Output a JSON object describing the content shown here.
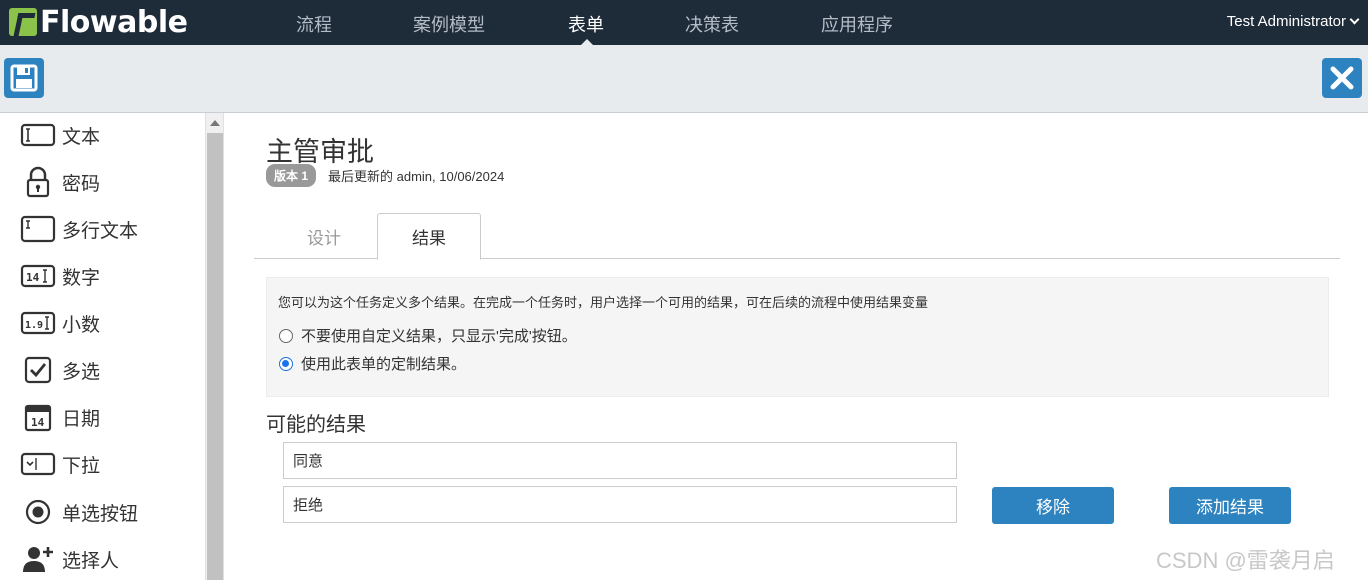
{
  "app": {
    "logo_text": "Flowable",
    "nav": [
      {
        "label": "流程",
        "active": false
      },
      {
        "label": "案例模型",
        "active": false
      },
      {
        "label": "表单",
        "active": true
      },
      {
        "label": "决策表",
        "active": false
      },
      {
        "label": "应用程序",
        "active": false
      }
    ],
    "user": "Test Administrator"
  },
  "toolbar": {
    "save_icon": "floppy-disk-icon",
    "close_icon": "close-x-icon"
  },
  "palette": {
    "items": [
      {
        "label": "文本",
        "icon": "text-field-icon"
      },
      {
        "label": "密码",
        "icon": "lock-icon"
      },
      {
        "label": "多行文本",
        "icon": "multiline-text-icon"
      },
      {
        "label": "数字",
        "icon": "number-icon"
      },
      {
        "label": "小数",
        "icon": "decimal-icon"
      },
      {
        "label": "多选",
        "icon": "checkbox-icon"
      },
      {
        "label": "日期",
        "icon": "calendar-icon"
      },
      {
        "label": "下拉",
        "icon": "dropdown-icon"
      },
      {
        "label": "单选按钮",
        "icon": "radio-button-icon"
      },
      {
        "label": "选择人",
        "icon": "add-person-icon"
      }
    ]
  },
  "form": {
    "title": "主管审批",
    "version_badge": "版本 1",
    "last_updated": "最后更新的 admin, 10/06/2024",
    "tabs": [
      {
        "label": "设计",
        "active": false
      },
      {
        "label": "结果",
        "active": true
      }
    ],
    "outcomes_panel": {
      "description": "您可以为这个任务定义多个结果。在完成一个任务时，用户选择一个可用的结果，可在后续的流程中使用结果变量",
      "options": [
        {
          "label": "不要使用自定义结果，只显示'完成'按钮。",
          "selected": false
        },
        {
          "label": "使用此表单的定制结果。",
          "selected": true
        }
      ]
    },
    "possible_outcomes_title": "可能的结果",
    "outcomes": [
      "同意",
      "拒绝"
    ],
    "remove_label": "移除",
    "add_label": "添加结果"
  },
  "watermark": "CSDN @雷袭月启",
  "colors": {
    "nav_bg": "#1e2b39",
    "accent": "#2d83bf",
    "logo_green": "#8bc34a",
    "radio_on": "#1a73e8"
  }
}
